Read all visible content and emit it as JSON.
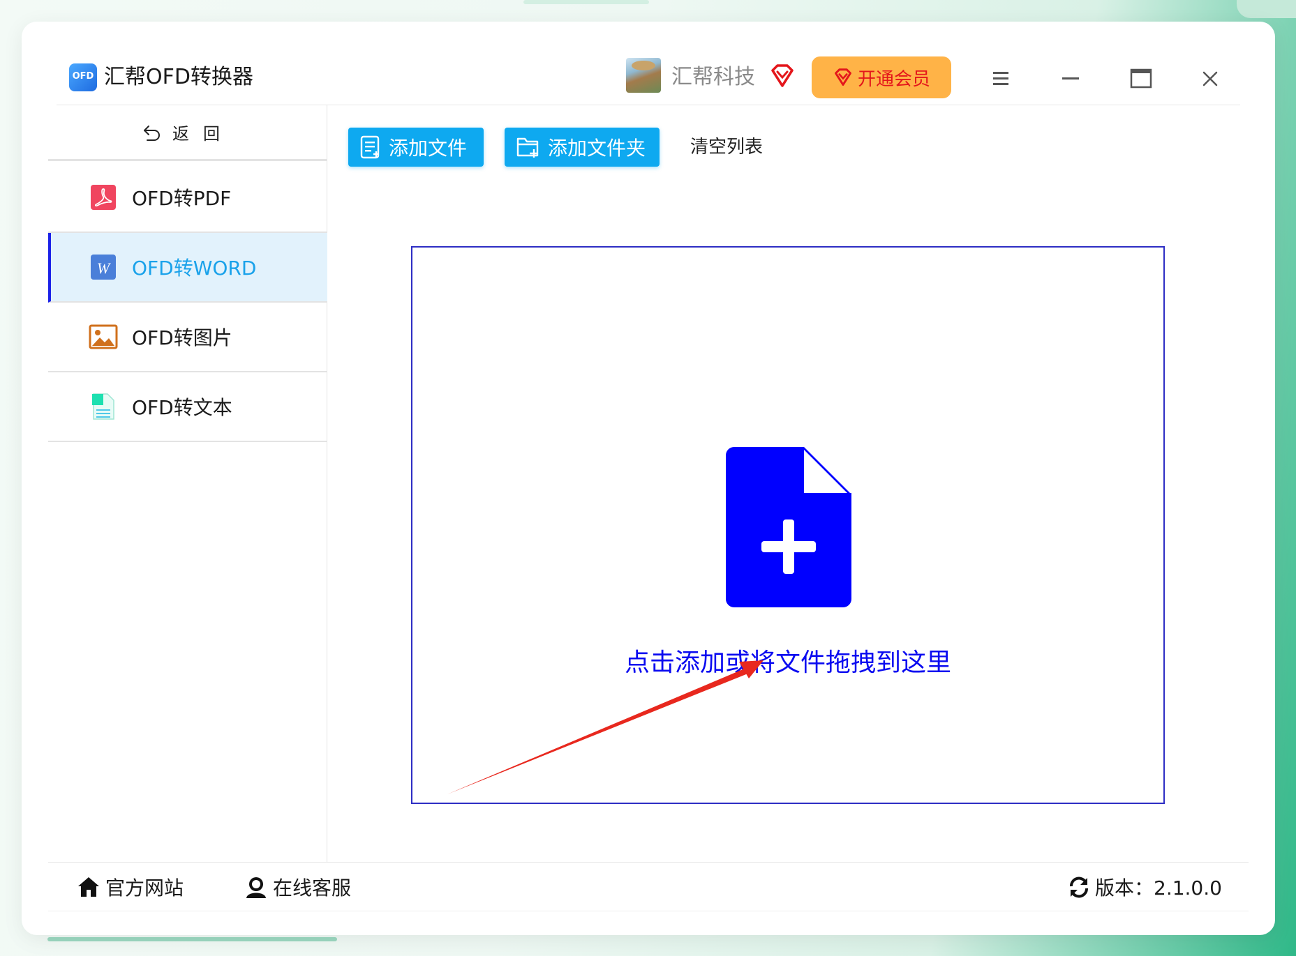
{
  "app": {
    "title": "汇帮OFD转换器",
    "logo_text": "OFD"
  },
  "header": {
    "username": "汇帮科技",
    "vip_button_label": "开通会员"
  },
  "sidebar": {
    "back_label": "返回",
    "items": [
      {
        "label": "OFD转PDF",
        "icon": "pdf-icon",
        "active": false
      },
      {
        "label": "OFD转WORD",
        "icon": "word-icon",
        "active": true
      },
      {
        "label": "OFD转图片",
        "icon": "image-icon",
        "active": false
      },
      {
        "label": "OFD转文本",
        "icon": "text-file-icon",
        "active": false
      }
    ]
  },
  "toolbar": {
    "add_file_label": "添加文件",
    "add_folder_label": "添加文件夹",
    "clear_list_label": "清空列表"
  },
  "dropzone": {
    "hint_text": "点击添加或将文件拖拽到这里"
  },
  "footer": {
    "website_label": "官方网站",
    "support_label": "在线客服",
    "version_label": "版本：2.1.0.0"
  },
  "colors": {
    "accent_blue": "#0ea9f0",
    "active_text": "#1aa2ea",
    "active_bg": "#e2f2fc",
    "dropzone_border": "#2e2ec4",
    "drop_icon": "#0a0af0",
    "vip_button_bg": "#ffb347",
    "vip_text": "#e4161b",
    "annotation_arrow": "#e8281e"
  }
}
